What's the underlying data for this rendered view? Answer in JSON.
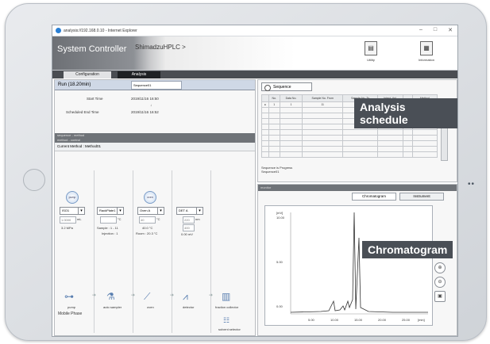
{
  "browser": {
    "url": "analysis://192.168.0.10 - Internet Explorer",
    "controls": [
      "–",
      "□",
      "✕"
    ]
  },
  "header": {
    "app_title": "System Controller",
    "instrument": "ShimadzuHPLC  >",
    "buttons": [
      {
        "label": "Utility",
        "icon": "utility-icon"
      },
      {
        "label": "Information",
        "icon": "information-icon"
      }
    ]
  },
  "tabs": [
    "Configuration",
    "Analysis"
  ],
  "run": {
    "label": "Run (18.20min)",
    "sequence_name": "Sequence01",
    "start_label": "Start Time",
    "start_value": "2019/11/16 16:50",
    "sep": "↓",
    "end_label": "Scheduled End Time",
    "end_value": "2019/11/16 16:52"
  },
  "sections": {
    "sequence": "sequence - method",
    "method": "method - control",
    "current_method": "Current Method : Method01"
  },
  "modules": [
    {
      "circle": "pump",
      "select": "ISO1",
      "box": "1.0000",
      "unit": "mL",
      "status": "3.2 MPa",
      "name": "pump"
    },
    {
      "circle": "",
      "select": "RackPlate1",
      "box": "",
      "unit": "°C",
      "status": "Sample : 1 - 11",
      "status2": "Injection : 1",
      "name": "auto sampler"
    },
    {
      "circle": "oven",
      "select": "Oven A",
      "box": "40",
      "unit": "°C",
      "status": "40.0 °C",
      "status2": "Room : 20.3 °C",
      "name": "oven"
    },
    {
      "circle": "",
      "select": "DET A",
      "box": "220",
      "box2": "400",
      "unit": "nm",
      "status": "0.00 mV",
      "name": "detector"
    },
    {
      "circle": "",
      "select": "",
      "name": "fraction collector"
    }
  ],
  "mobile_phase": "Mobile Phase",
  "solvent_label": "solvent selector",
  "sequence_panel": {
    "button": "Sequence",
    "headers": [
      "",
      "No.",
      "Data No.",
      "Sample No. From",
      "Sample No. To",
      "Inject. Vol.",
      "",
      "",
      "Method"
    ],
    "first_row": [
      "●",
      "1",
      "1",
      "11",
      "11",
      "1",
      "10",
      "Method01"
    ],
    "in_progress": "Sequence is Progress",
    "in_progress_value": "Sequence01"
  },
  "chromatogram_panel": {
    "header": "monitor",
    "tabs": [
      "Chromatogram",
      "Instrument"
    ],
    "yunit": "[mV]",
    "yticks": [
      "10.00",
      "5.00",
      "0.00"
    ],
    "xticks": [
      "5.00",
      "10.00",
      "15.00",
      "20.00",
      "25.00"
    ],
    "xunit": "[min]"
  },
  "callouts": {
    "schedule": "Analysis schedule",
    "chromatogram": "Chromatogram"
  },
  "colors": {
    "callout_bg": "#4a4f56",
    "header_dark": "#6d7075",
    "run_bg": "#cfd8e6",
    "peak_line": "#333333"
  }
}
